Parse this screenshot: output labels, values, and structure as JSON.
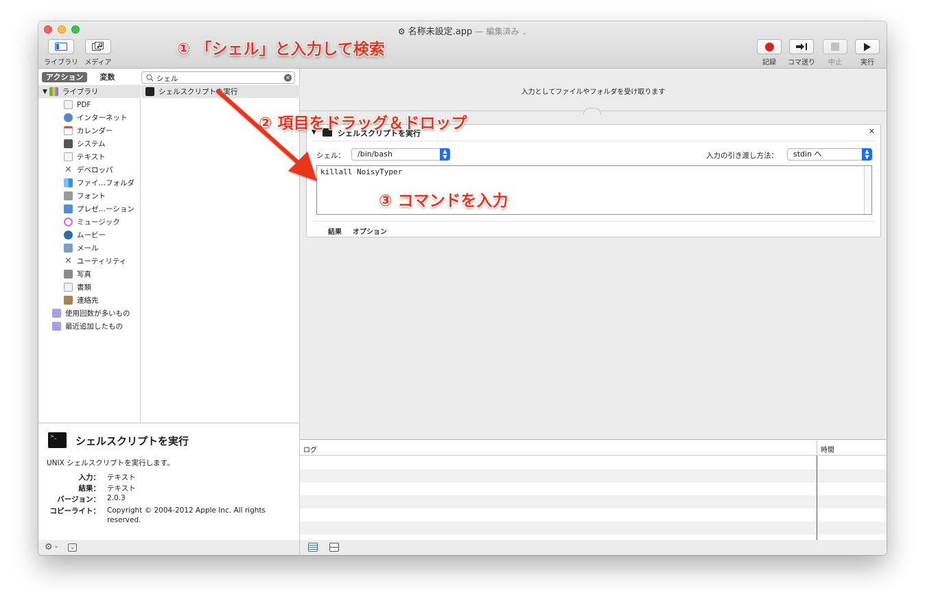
{
  "window": {
    "title": "名称未設定.app",
    "title_separator": "—",
    "title_status": "編集済み"
  },
  "toolbar": {
    "library_label": "ライブラリ",
    "media_label": "メディア",
    "record_label": "記録",
    "step_label": "コマ送り",
    "stop_label": "中止",
    "run_label": "実行"
  },
  "library": {
    "tabs": [
      "アクション",
      "変数"
    ],
    "search_value": "シェル",
    "categories": [
      {
        "label": "ライブラリ",
        "icon": "library-icon",
        "color": "#8a7fd0"
      },
      {
        "label": "PDF",
        "icon": "pdf-icon",
        "color": "#e8e8e8"
      },
      {
        "label": "インターネット",
        "icon": "globe-icon",
        "color": "#5a86c8"
      },
      {
        "label": "カレンダー",
        "icon": "calendar-icon",
        "color": "#ffffff"
      },
      {
        "label": "システム",
        "icon": "system-icon",
        "color": "#555555"
      },
      {
        "label": "テキスト",
        "icon": "text-icon",
        "color": "#f4f4f4"
      },
      {
        "label": "デベロッパ",
        "icon": "developer-icon",
        "color": "#777777"
      },
      {
        "label": "ファイ…フォルダ",
        "icon": "finder-icon",
        "color": "#3f8fe0"
      },
      {
        "label": "フォント",
        "icon": "font-icon",
        "color": "#9a9a9a"
      },
      {
        "label": "プレゼ…ーション",
        "icon": "presentation-icon",
        "color": "#4f8fd8"
      },
      {
        "label": "ミュージック",
        "icon": "music-icon",
        "color": "#c76bd6"
      },
      {
        "label": "ムービー",
        "icon": "movie-icon",
        "color": "#2e6ea6"
      },
      {
        "label": "メール",
        "icon": "mail-icon",
        "color": "#7aa0c8"
      },
      {
        "label": "ユーティリティ",
        "icon": "utility-icon",
        "color": "#777777"
      },
      {
        "label": "写真",
        "icon": "photo-icon",
        "color": "#8a8a8a"
      },
      {
        "label": "書類",
        "icon": "document-icon",
        "color": "#f0f0f0"
      },
      {
        "label": "連絡先",
        "icon": "contacts-icon",
        "color": "#a5834e"
      },
      {
        "label": "使用回数が多いもの",
        "icon": "smart-folder-icon",
        "color": "#a99ee6"
      },
      {
        "label": "最近追加したもの",
        "icon": "smart-folder-icon",
        "color": "#a99ee6"
      }
    ],
    "results": [
      "シェルスクリプトを実行"
    ]
  },
  "description": {
    "title": "シェルスクリプトを実行",
    "summary": "UNIX シェルスクリプトを実行します。",
    "input_key": "入力：",
    "input_value": "テキスト",
    "result_key": "結果：",
    "result_value": "テキスト",
    "version_key": "バージョン：",
    "version_value": "2.0.3",
    "copyright_key": "コピーライト：",
    "copyright_value": "Copyright © 2004-2012 Apple Inc.  All rights reserved."
  },
  "workflow": {
    "header_text": "入力としてファイルやフォルダを受け取ります",
    "action_title": "シェルスクリプトを実行",
    "shell_label": "シェル：",
    "shell_value": "/bin/bash",
    "pass_label": "入力の引き渡し方法：",
    "pass_value": "stdin へ",
    "script": "killall NoisyTyper",
    "tab_results": "結果",
    "tab_options": "オプション"
  },
  "log": {
    "col_log": "ログ",
    "col_time": "時間"
  },
  "annotations": {
    "step1": "① 「シェル」と入力して検索",
    "step2": "② 項目をドラッグ＆ドロップ",
    "step3": "③ コマンドを入力"
  },
  "colors": {
    "annotation": "#e8341f",
    "record_dot": "#d0261d",
    "popup_accent": "#1e6ff0"
  }
}
